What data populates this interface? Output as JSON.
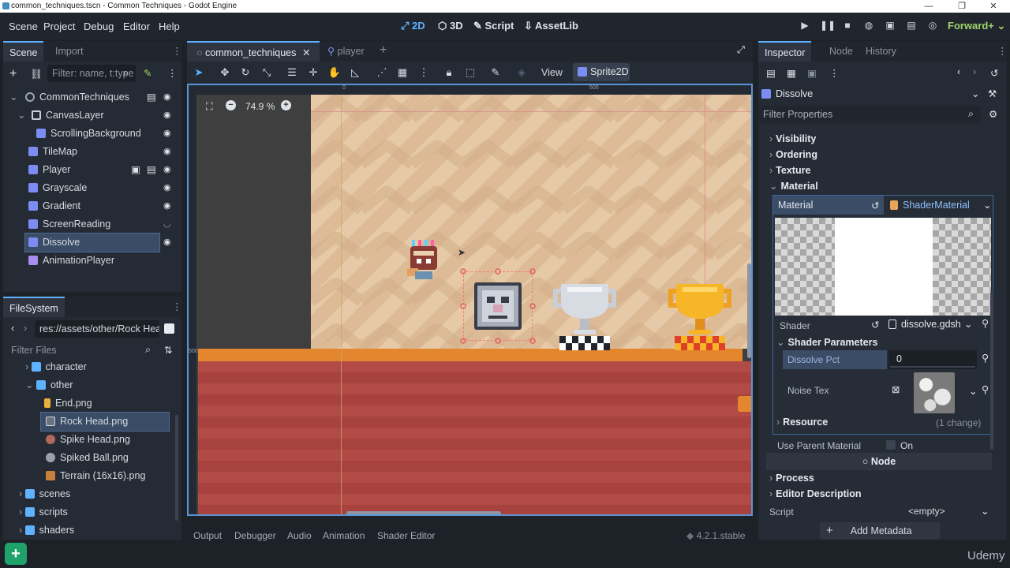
{
  "window": {
    "title": "common_techniques.tscn - Common Techniques - Godot Engine",
    "minimize": "—",
    "restore": "❐",
    "close": "✕"
  },
  "menu": [
    "Scene",
    "Project",
    "Debug",
    "Editor",
    "Help"
  ],
  "modes": {
    "m2d": "2D",
    "m3d": "3D",
    "script": "Script",
    "assetlib": "AssetLib"
  },
  "renderer": "Forward+",
  "scene_dock": {
    "tabs": [
      "Scene",
      "Import"
    ],
    "filter_placeholder": "Filter: name, t:type",
    "nodes": [
      {
        "label": "CommonTechniques",
        "indent": 0,
        "color": "#9aa4b2"
      },
      {
        "label": "CanvasLayer",
        "indent": 1,
        "color": "#c7ced8"
      },
      {
        "label": "ScrollingBackground",
        "indent": 2,
        "color": "#7d8cf3"
      },
      {
        "label": "TileMap",
        "indent": 1,
        "color": "#7d8cf3"
      },
      {
        "label": "Player",
        "indent": 1,
        "color": "#7d8cf3"
      },
      {
        "label": "Grayscale",
        "indent": 1,
        "color": "#7d8cf3"
      },
      {
        "label": "Gradient",
        "indent": 1,
        "color": "#7d8cf3"
      },
      {
        "label": "ScreenReading",
        "indent": 1,
        "color": "#7d8cf3"
      },
      {
        "label": "Dissolve",
        "indent": 1,
        "color": "#7d8cf3",
        "selected": true
      },
      {
        "label": "AnimationPlayer",
        "indent": 1,
        "color": "#a88cf0"
      }
    ]
  },
  "filesystem": {
    "title": "FileSystem",
    "path": "res://assets/other/Rock Hea",
    "filter_placeholder": "Filter Files",
    "items": [
      {
        "label": "character",
        "type": "folder",
        "indent": 1,
        "open": false
      },
      {
        "label": "other",
        "type": "folder",
        "indent": 1,
        "open": true
      },
      {
        "label": "End.png",
        "type": "file",
        "indent": 2
      },
      {
        "label": "Rock Head.png",
        "type": "file",
        "indent": 2,
        "selected": true
      },
      {
        "label": "Spike Head.png",
        "type": "file",
        "indent": 2
      },
      {
        "label": "Spiked Ball.png",
        "type": "file",
        "indent": 2
      },
      {
        "label": "Terrain (16x16).png",
        "type": "file",
        "indent": 2
      },
      {
        "label": "scenes",
        "type": "folder",
        "indent": 0,
        "open": false
      },
      {
        "label": "scripts",
        "type": "folder",
        "indent": 0,
        "open": false
      },
      {
        "label": "shaders",
        "type": "folder",
        "indent": 0,
        "open": false
      }
    ]
  },
  "editor_tabs": [
    "common_techniques",
    "player"
  ],
  "toolbar": {
    "view": "View",
    "node_type": "Sprite2D"
  },
  "viewport": {
    "zoom": "74.9 %",
    "ruler_0": "0",
    "ruler_500": "500",
    "ruler_v500": "500"
  },
  "bottom_panel": {
    "tabs": [
      "Output",
      "Debugger",
      "Audio",
      "Animation",
      "Shader Editor"
    ],
    "version": "4.2.1.stable"
  },
  "inspector": {
    "tabs": [
      "Inspector",
      "Node",
      "History"
    ],
    "node_name": "Dissolve",
    "filter_placeholder": "Filter Properties",
    "sections": [
      "Visibility",
      "Ordering",
      "Texture",
      "Material"
    ],
    "material_label": "Material",
    "material_value": "ShaderMaterial",
    "shader_label": "Shader",
    "shader_value": "dissolve.gdsh",
    "shader_params": "Shader Parameters",
    "dissolve_pct_label": "Dissolve Pct",
    "dissolve_pct_value": "0",
    "noise_tex_label": "Noise Tex",
    "resource": "Resource",
    "resource_changes": "(1 change)",
    "use_parent_label": "Use Parent Material",
    "use_parent_value": "On",
    "node_header": "Node",
    "process": "Process",
    "editor_description": "Editor Description",
    "script_label": "Script",
    "script_value": "<empty>",
    "add_metadata": "Add Metadata"
  },
  "watermark": "Udemy"
}
